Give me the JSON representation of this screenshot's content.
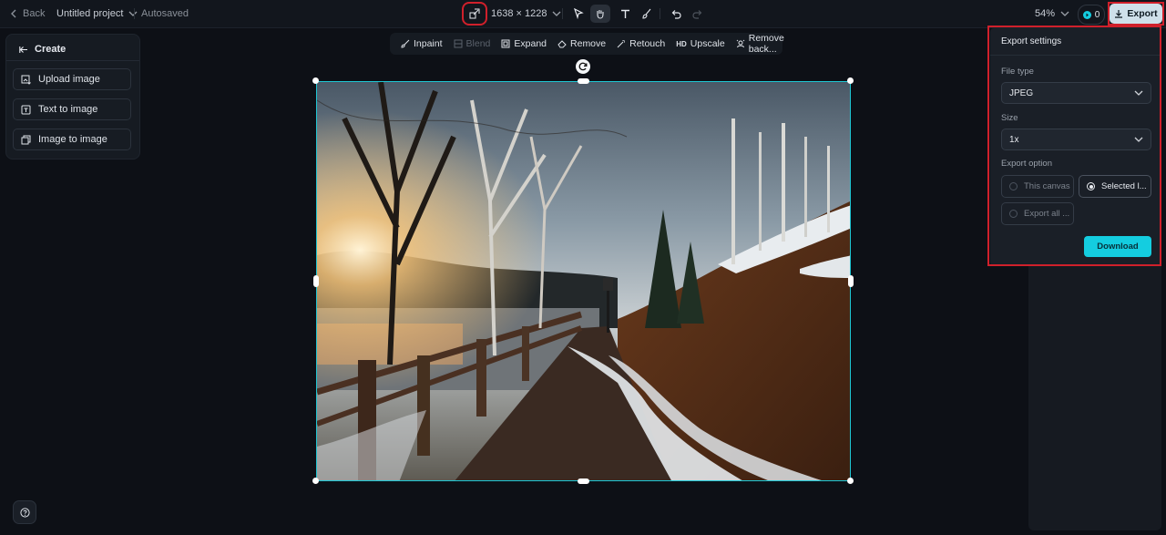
{
  "topbar": {
    "back_label": "Back",
    "project_name": "Untitled project",
    "save_status": "Autosaved",
    "canvas_size": "1638 × 1228",
    "zoom": "54%",
    "credits": "0",
    "export_label": "Export"
  },
  "left_panel": {
    "title": "Create",
    "buttons": [
      "Upload image",
      "Text to image",
      "Image to image"
    ]
  },
  "tool_strip": {
    "items": [
      "Inpaint",
      "Blend",
      "Expand",
      "Remove",
      "Retouch",
      "Upscale",
      "Remove back..."
    ],
    "hd_badge": "HD"
  },
  "export_panel": {
    "title": "Export settings",
    "file_type_label": "File type",
    "file_type_value": "JPEG",
    "size_label": "Size",
    "size_value": "1x",
    "export_option_label": "Export option",
    "options": [
      {
        "label": "This canvas",
        "selected": false
      },
      {
        "label": "Selected l...",
        "selected": true
      },
      {
        "label": "Export all ...",
        "selected": false
      }
    ],
    "download_label": "Download"
  },
  "colors": {
    "accent": "#14cde0",
    "selection_border": "#1fc7d4",
    "highlight_frame": "#d0202b",
    "background": "#0d1016"
  }
}
